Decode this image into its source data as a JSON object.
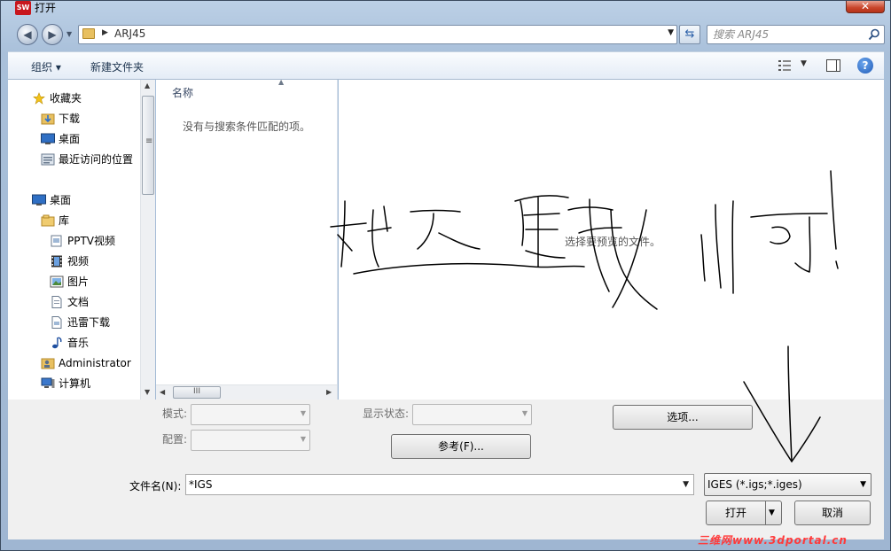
{
  "window": {
    "title": "打开",
    "app_icon_text": "SW",
    "close_symbol": "✕"
  },
  "address": {
    "crumb": "ARJ45"
  },
  "search": {
    "placeholder": "搜索 ARJ45"
  },
  "toolbar": {
    "organize_label": "组织 ▾",
    "new_folder_label": "新建文件夹"
  },
  "sidebar": {
    "items": [
      {
        "label": "收藏夹",
        "icon": "star-icon"
      },
      {
        "label": "下载",
        "icon": "download-folder-icon"
      },
      {
        "label": "桌面",
        "icon": "desktop-icon"
      },
      {
        "label": "最近访问的位置",
        "icon": "recent-places-icon"
      },
      {
        "label": "桌面",
        "icon": "desktop-icon"
      },
      {
        "label": "库",
        "icon": "library-icon"
      },
      {
        "label": "PPTV视频",
        "icon": "video-library-icon"
      },
      {
        "label": "视频",
        "icon": "film-icon"
      },
      {
        "label": "图片",
        "icon": "picture-icon"
      },
      {
        "label": "文档",
        "icon": "document-icon"
      },
      {
        "label": "迅雷下载",
        "icon": "thunder-download-icon"
      },
      {
        "label": "音乐",
        "icon": "music-icon"
      },
      {
        "label": "Administrator",
        "icon": "user-folder-icon"
      },
      {
        "label": "计算机",
        "icon": "computer-icon"
      }
    ]
  },
  "filelist": {
    "column_name": "名称",
    "empty_message": "没有与搜索条件匹配的项。"
  },
  "preview": {
    "message": "选择要预览的文件。"
  },
  "options": {
    "mode_label": "模式:",
    "config_label": "配置:",
    "display_state_label": "显示状态:",
    "options_button": "选项...",
    "reference_button": "参考(F)..."
  },
  "footer": {
    "filename_label": "文件名(N):",
    "filename_value": "*IGS",
    "filetype_value": "IGES (*.igs;*.iges)",
    "open_button": "打开",
    "cancel_button": "取消"
  },
  "watermark": "三维网www.3dportal.cn",
  "colors": {
    "title_bar": "#a9c0da",
    "close_button": "#c8442a",
    "watermark": "#ff3a3a"
  }
}
